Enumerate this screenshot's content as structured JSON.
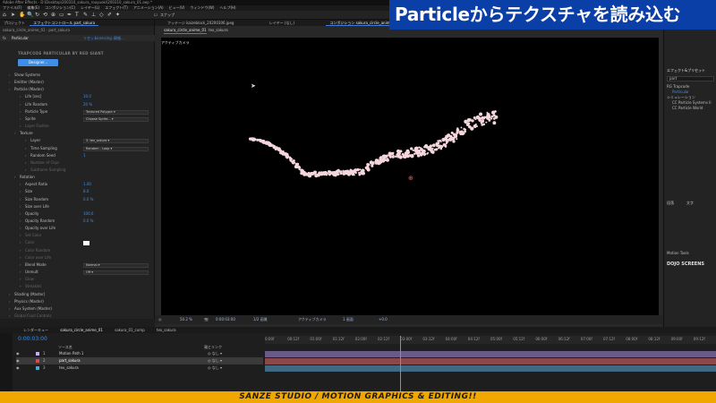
{
  "window": {
    "title": "Adobe After Effects - D:\\Desktop\\200310_sakura_rouyuoki\\200310_sakura_01.aep *"
  },
  "banner": {
    "text": "Particleからテクスチャを読み込む"
  },
  "footer": {
    "text": "SANZE STUDIO  / MOTION GRAPHICS & EDITING!!"
  },
  "menu": [
    "ファイル(F)",
    "編集(E)",
    "コンポジション(C)",
    "レイヤー(L)",
    "エフェクト(T)",
    "アニメーション(A)",
    "ビュー(V)",
    "ウィンドウ(W)",
    "ヘルプ(H)"
  ],
  "toolbar": {
    "snap_label": "スナップ"
  },
  "left_panel": {
    "tabs": [
      "プロジェクト",
      "エフェクトコントロール part_sakura"
    ],
    "breadcrumb": "sakura_circle_anime_01 · part_sakura",
    "effect_name": "Particular",
    "effect_links": [
      "リセット",
      "Licensing...",
      "情報..."
    ],
    "brand": "TRAPCODE PARTICULAR BY RED GIANT",
    "designer_button": "Designer...",
    "rows": [
      {
        "label": "Show Systems",
        "indent": 1
      },
      {
        "label": "Emitter (Master)",
        "indent": 1
      },
      {
        "label": "Particle (Master)",
        "indent": 1
      },
      {
        "label": "Life [sec]",
        "value": "10.0",
        "indent": 3
      },
      {
        "label": "Life Random",
        "value": "20 %",
        "indent": 3
      },
      {
        "label": "Particle Type",
        "select": "Textured Polygon",
        "indent": 3
      },
      {
        "label": "Sprite",
        "select": "Choose Sprite...",
        "indent": 3
      },
      {
        "label": "Layer Fiodine",
        "dim": true,
        "indent": 3
      },
      {
        "label": "Texture",
        "indent": 2
      },
      {
        "label": "Layer",
        "select": "3. tex_sakura",
        "indent": 4
      },
      {
        "label": "Time Sampling",
        "select": "Random - Loop",
        "indent": 4
      },
      {
        "label": "Random Seed",
        "value": "1",
        "indent": 4
      },
      {
        "label": "Number of Clips",
        "dim": true,
        "indent": 4
      },
      {
        "label": "Subframe Sampling",
        "dim": true,
        "indent": 4
      },
      {
        "label": "Rotation",
        "indent": 2
      },
      {
        "label": "Aspect Ratio",
        "value": "1.00",
        "indent": 3
      },
      {
        "label": "Size",
        "value": "8.0",
        "indent": 3
      },
      {
        "label": "Size Random",
        "value": "0.0 %",
        "indent": 3
      },
      {
        "label": "Size over Life",
        "indent": 3
      },
      {
        "label": "Opacity",
        "value": "100.0",
        "indent": 3
      },
      {
        "label": "Opacity Random",
        "value": "0.0 %",
        "indent": 3
      },
      {
        "label": "Opacity over Life",
        "indent": 3
      },
      {
        "label": "Set Color",
        "dim": true,
        "indent": 3
      },
      {
        "label": "Color",
        "swatch": true,
        "dim": true,
        "indent": 3
      },
      {
        "label": "Color Random",
        "dim": true,
        "indent": 3
      },
      {
        "label": "Color over Life",
        "dim": true,
        "indent": 3
      },
      {
        "label": "Blend Mode",
        "select": "Normal",
        "indent": 3
      },
      {
        "label": "Unmult",
        "select": "Off",
        "indent": 3
      },
      {
        "label": "Glow",
        "dim": true,
        "indent": 3
      },
      {
        "label": "Streaklet",
        "dim": true,
        "indent": 3
      },
      {
        "label": "Shading (Master)",
        "indent": 1
      },
      {
        "label": "Physics (Master)",
        "indent": 1
      },
      {
        "label": "Aux System (Master)",
        "indent": 1
      },
      {
        "label": "Global Fluid Controls",
        "dim": true,
        "indent": 1
      }
    ]
  },
  "viewer": {
    "tabs": [
      "フッテージ kaizeblock_20200306.jpeg",
      "レイヤー (なし)",
      "コンポジション sakura_circle_anime_01"
    ],
    "sub_tabs": [
      "sakura_circle_anime_01",
      "tex_sakura"
    ],
    "label": "アクティブカメラ",
    "zoom": "50.2 %",
    "timecode": "0:00:03:00",
    "resolution": "1/2 画質",
    "camera": "アクティブカメラ",
    "views": "1 画面",
    "offset": "+0.0"
  },
  "right_panel": {
    "info_tab": "情報",
    "effects_title": "エフェクト&プリセット",
    "search": "part",
    "tree": [
      "RG Trapcode",
      "Particular",
      "シミュレーション",
      "CC Particle Systems II",
      "CC Particle World"
    ],
    "para_tab": "段落",
    "char_tab": "文字",
    "motion_tab": "Motion Tools",
    "dojo": "DOJO SCREENS"
  },
  "timeline": {
    "tabs": [
      "レンダーキュー",
      "sakura_circle_anime_01",
      "sakura_01_comp",
      "tex_sakura"
    ],
    "timecode": "0:00:03:00",
    "columns": [
      "ソース名",
      "親とリンク"
    ],
    "layers": [
      {
        "num": "1",
        "name": "Motion Path 1",
        "parent": "なし",
        "color": "#c9a8ff",
        "selected": false
      },
      {
        "num": "2",
        "name": "part_sakura",
        "parent": "なし",
        "color": "#d94a4a",
        "selected": true
      },
      {
        "num": "3",
        "name": "tex_sakura",
        "parent": "なし",
        "color": "#4aa8d9",
        "selected": false
      }
    ],
    "ruler": [
      "0:00f",
      "00:12f",
      "01:00f",
      "01:12f",
      "02:00f",
      "02:12f",
      "03:00f",
      "03:12f",
      "04:00f",
      "04:12f",
      "05:00f",
      "05:12f",
      "06:00f",
      "06:12f",
      "07:00f",
      "07:12f",
      "08:00f",
      "08:12f",
      "09:00f",
      "09:12f"
    ],
    "playhead_seconds": 3
  },
  "colors": {
    "banner_bg": "#0b3fa8",
    "footer_bg": "#f0a800",
    "accent_blue": "#3f8ee8",
    "particle": "#f5d6dc"
  }
}
